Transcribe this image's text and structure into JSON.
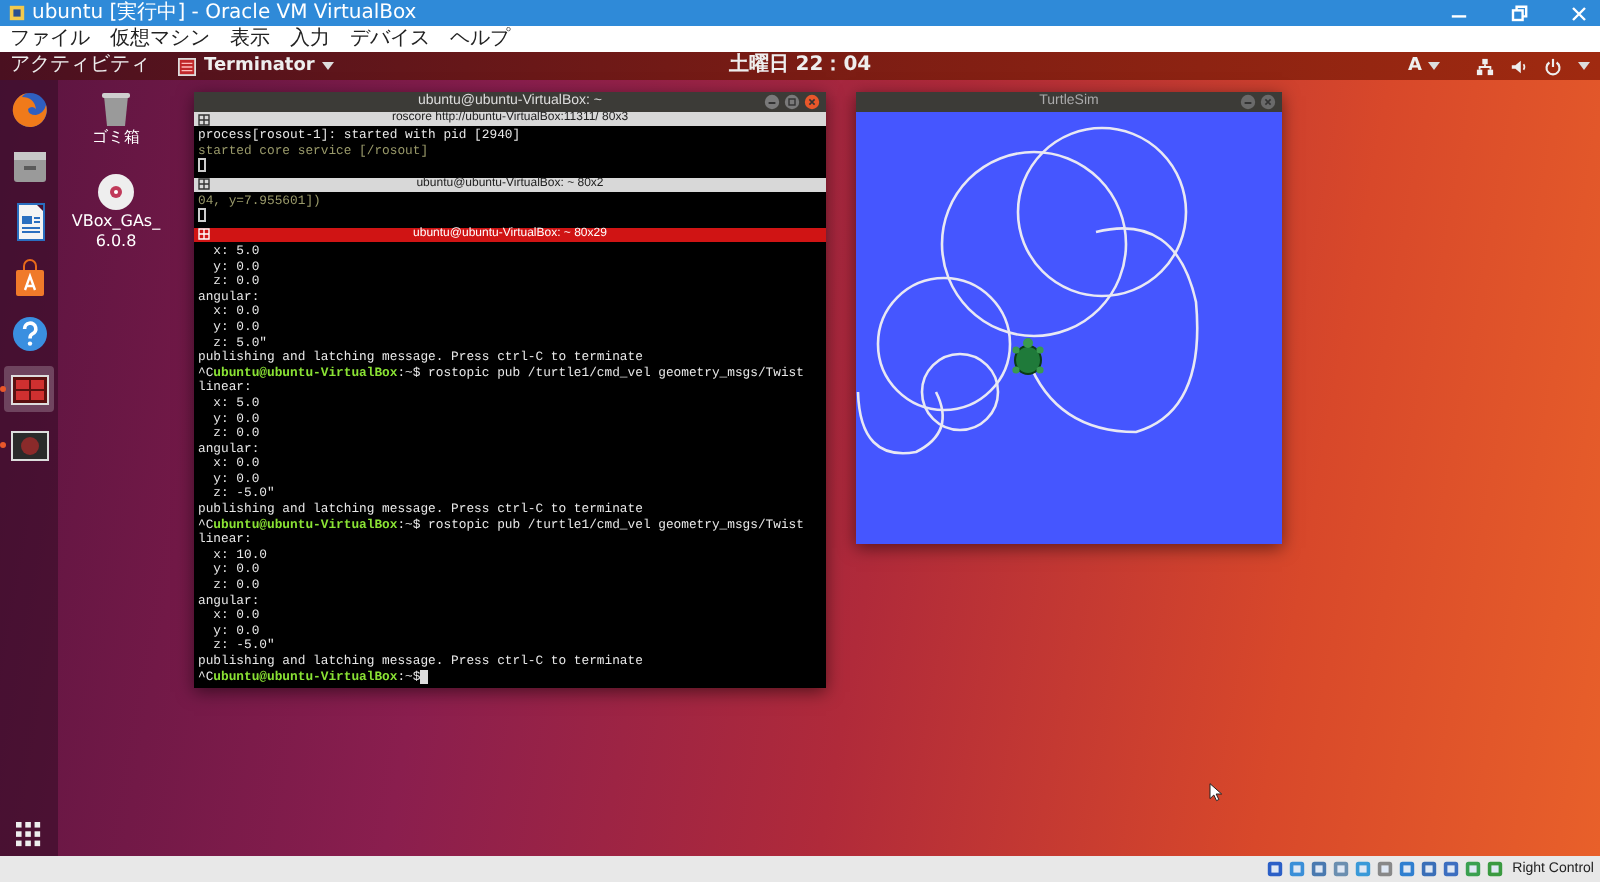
{
  "vbox": {
    "title": "ubuntu [実行中] - Oracle VM VirtualBox",
    "menu": [
      "ファイル",
      "仮想マシン",
      "表示",
      "入力",
      "デバイス",
      "ヘルプ"
    ],
    "status_text": "Right Control"
  },
  "topbar": {
    "activities": "アクティビティ",
    "app": "Terminator",
    "clock": "土曜日 22：04",
    "input_method": "A"
  },
  "dock": [
    {
      "kind": "browser",
      "selected": false,
      "running": false
    },
    {
      "kind": "files",
      "selected": false,
      "running": false
    },
    {
      "kind": "document",
      "selected": false,
      "running": false
    },
    {
      "kind": "store",
      "selected": false,
      "running": false
    },
    {
      "kind": "help",
      "selected": false,
      "running": false
    },
    {
      "kind": "terminal",
      "selected": true,
      "running": true
    },
    {
      "kind": "app",
      "selected": false,
      "running": true
    }
  ],
  "desktop_icons": [
    {
      "kind": "trash",
      "lines": [
        "ゴミ箱"
      ]
    },
    {
      "kind": "disc",
      "lines": [
        "VBox_GAs_",
        "6.0.8"
      ]
    }
  ],
  "terminal": {
    "title": "ubuntu@ubuntu-VirtualBox: ~",
    "panes": [
      {
        "title": "roscore http://ubuntu-VirtualBox:11311/ 80x3",
        "focused": false,
        "lines": [
          {
            "kind": "output",
            "text": "process[rosout-1]: started with pid [2940]"
          },
          {
            "kind": "dim",
            "text": "started core service [/rosout]"
          }
        ]
      },
      {
        "title": "ubuntu@ubuntu-VirtualBox: ~ 80x2",
        "focused": false,
        "lines": [
          {
            "kind": "dim",
            "text": "04, y=7.955601])"
          }
        ]
      },
      {
        "title": "ubuntu@ubuntu-VirtualBox: ~ 80x29",
        "focused": true,
        "lines": [
          {
            "kind": "output",
            "text": "  x: 5.0"
          },
          {
            "kind": "output",
            "text": "  y: 0.0"
          },
          {
            "kind": "output",
            "text": "  z: 0.0"
          },
          {
            "kind": "output",
            "text": "angular:"
          },
          {
            "kind": "output",
            "text": "  x: 0.0"
          },
          {
            "kind": "output",
            "text": "  y: 0.0"
          },
          {
            "kind": "output",
            "text": "  z: 5.0\""
          },
          {
            "kind": "output",
            "text": "publishing and latching message. Press ctrl-C to terminate"
          },
          {
            "kind": "prompt",
            "interrupt": "^C",
            "user": "ubuntu@ubuntu-VirtualBox",
            "text": ":~$ rostopic pub /turtle1/cmd_vel geometry_msgs/Twist"
          },
          {
            "kind": "output",
            "text": "linear:"
          },
          {
            "kind": "output",
            "text": "  x: 5.0"
          },
          {
            "kind": "output",
            "text": "  y: 0.0"
          },
          {
            "kind": "output",
            "text": "  z: 0.0"
          },
          {
            "kind": "output",
            "text": "angular:"
          },
          {
            "kind": "output",
            "text": "  x: 0.0"
          },
          {
            "kind": "output",
            "text": "  y: 0.0"
          },
          {
            "kind": "output",
            "text": "  z: -5.0\""
          },
          {
            "kind": "output",
            "text": "publishing and latching message. Press ctrl-C to terminate"
          },
          {
            "kind": "prompt",
            "interrupt": "^C",
            "user": "ubuntu@ubuntu-VirtualBox",
            "text": ":~$ rostopic pub /turtle1/cmd_vel geometry_msgs/Twist"
          },
          {
            "kind": "output",
            "text": "linear:"
          },
          {
            "kind": "output",
            "text": "  x: 10.0"
          },
          {
            "kind": "output",
            "text": "  y: 0.0"
          },
          {
            "kind": "output",
            "text": "  z: 0.0"
          },
          {
            "kind": "output",
            "text": "angular:"
          },
          {
            "kind": "output",
            "text": "  x: 0.0"
          },
          {
            "kind": "output",
            "text": "  y: 0.0"
          },
          {
            "kind": "output",
            "text": "  z: -5.0\""
          },
          {
            "kind": "output",
            "text": "publishing and latching message. Press ctrl-C to terminate"
          },
          {
            "kind": "prompt",
            "interrupt": "^C",
            "user": "ubuntu@ubuntu-VirtualBox",
            "text": ":~$"
          }
        ]
      }
    ]
  },
  "turtlesim": {
    "title": "TurtleSim"
  }
}
